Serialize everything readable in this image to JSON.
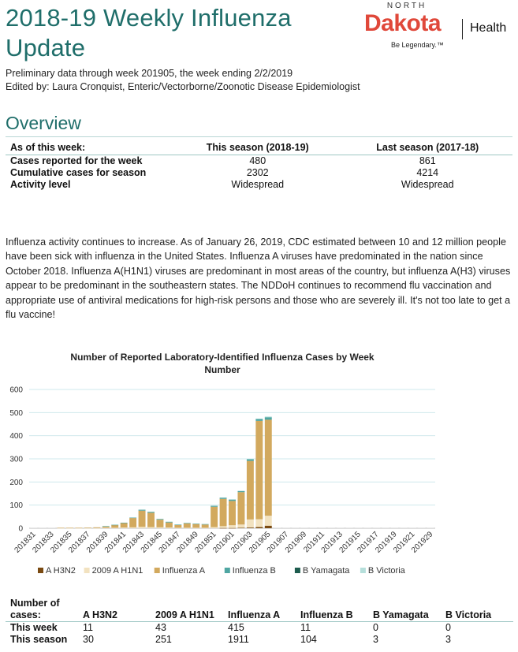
{
  "header": {
    "title": "2018-19 Weekly Influenza Update",
    "subtitle1": "Preliminary data through week 201905, the week ending 2/2/2019",
    "subtitle2": "Edited by: Laura Cronquist, Enteric/Vectorborne/Zoonotic Disease Epidemiologist"
  },
  "logo": {
    "north": "NORTH",
    "dakota": "Dakota",
    "health": "Health",
    "slogan": "Be Legendary.™"
  },
  "overview": {
    "heading": "Overview",
    "columns": [
      "As of this week:",
      "This season (2018-19)",
      "Last season (2017-18)"
    ],
    "rows": [
      {
        "label": "Cases reported for the week",
        "this": "480",
        "last": "861"
      },
      {
        "label": "Cumulative cases for season",
        "this": "2302",
        "last": "4214"
      },
      {
        "label": "Activity level",
        "this": "Widespread",
        "last": "Widespread"
      }
    ]
  },
  "paragraph": "Influenza activity continues to increase. As of January 26, 2019, CDC estimated between 10 and 12 million people have been sick with influenza in the United States. Influenza A viruses have predominated in the nation since October 2018. Influenza A(H1N1) viruses are predominant in most areas of the country, but influenza A(H3) viruses appear to be predominant in the southeastern states. The NDDoH continues to recommend flu vaccination and appropriate use of antiviral medications for high-risk persons and those who are severely ill. It's not too late to get a flu vaccine!",
  "chart_data": {
    "type": "bar",
    "stacked": true,
    "title": "Number of Reported Laboratory-Identified Influenza Cases by Week Number",
    "title_lines": [
      "Number of Reported Laboratory-Identified Influenza Cases by Week",
      "Number"
    ],
    "ylim": [
      0,
      600
    ],
    "yticks": [
      0,
      100,
      200,
      300,
      400,
      500,
      600
    ],
    "grid": true,
    "legend_position": "bottom",
    "categories": [
      "201831",
      "201832",
      "201833",
      "201834",
      "201835",
      "201836",
      "201837",
      "201838",
      "201839",
      "201840",
      "201841",
      "201842",
      "201843",
      "201844",
      "201845",
      "201846",
      "201847",
      "201848",
      "201849",
      "201850",
      "201851",
      "201852",
      "201901",
      "201902",
      "201903",
      "201904",
      "201905",
      "201906",
      "201907",
      "201908",
      "201909",
      "201910",
      "201911",
      "201912",
      "201913",
      "201914",
      "201915",
      "201916",
      "201917",
      "201918",
      "201919",
      "201920",
      "201921",
      "201922",
      "201929"
    ],
    "tick_labels": [
      "201831",
      "201833",
      "201835",
      "201837",
      "201839",
      "201841",
      "201843",
      "201845",
      "201847",
      "201849",
      "201851",
      "201901",
      "201903",
      "201905",
      "201907",
      "201909",
      "201911",
      "201913",
      "201915",
      "201917",
      "201919",
      "201921",
      "201929"
    ],
    "series": [
      {
        "name": "A H3N2",
        "color": "#7a4a12",
        "values": [
          0,
          0,
          0,
          0,
          0,
          0,
          0,
          0,
          0,
          0,
          0,
          0,
          0,
          0,
          0,
          0,
          0,
          0,
          0,
          0,
          0,
          1,
          1,
          2,
          3,
          5,
          11,
          0,
          0,
          0,
          0,
          0,
          0,
          0,
          0,
          0,
          0,
          0,
          0,
          0,
          0,
          0,
          0,
          0,
          0
        ]
      },
      {
        "name": "2009 A H1N1",
        "color": "#f2e2c0",
        "values": [
          0,
          0,
          0,
          1,
          1,
          1,
          1,
          1,
          2,
          2,
          3,
          4,
          6,
          5,
          4,
          3,
          2,
          2,
          2,
          2,
          5,
          8,
          12,
          14,
          35,
          34,
          43,
          0,
          0,
          0,
          0,
          0,
          0,
          0,
          0,
          0,
          0,
          0,
          0,
          0,
          0,
          0,
          0,
          0,
          0
        ]
      },
      {
        "name": "Influenza A",
        "color": "#d2a95e",
        "values": [
          0,
          0,
          0,
          1,
          1,
          1,
          2,
          3,
          6,
          12,
          20,
          40,
          70,
          62,
          33,
          22,
          12,
          19,
          16,
          14,
          88,
          118,
          105,
          140,
          253,
          425,
          415,
          0,
          0,
          0,
          0,
          0,
          0,
          0,
          0,
          0,
          0,
          0,
          0,
          0,
          0,
          0,
          0,
          0,
          0
        ]
      },
      {
        "name": "Influenza B",
        "color": "#4fa6a2",
        "values": [
          0,
          0,
          0,
          0,
          0,
          0,
          0,
          0,
          1,
          1,
          1,
          2,
          4,
          4,
          3,
          3,
          2,
          2,
          2,
          2,
          4,
          5,
          6,
          5,
          8,
          9,
          11,
          0,
          0,
          0,
          0,
          0,
          0,
          0,
          0,
          0,
          0,
          0,
          0,
          0,
          0,
          0,
          0,
          0,
          0
        ]
      },
      {
        "name": "B Yamagata",
        "color": "#1d5c4e",
        "values": [
          0,
          0,
          0,
          0,
          0,
          0,
          0,
          0,
          0,
          0,
          0,
          0,
          0,
          0,
          0,
          0,
          0,
          0,
          0,
          0,
          0,
          0,
          0,
          0,
          0,
          0,
          0,
          0,
          0,
          0,
          0,
          0,
          0,
          0,
          0,
          0,
          0,
          0,
          0,
          0,
          0,
          0,
          0,
          0,
          0
        ]
      },
      {
        "name": "B Victoria",
        "color": "#b6dfdb",
        "values": [
          0,
          0,
          0,
          0,
          0,
          0,
          0,
          0,
          0,
          0,
          0,
          0,
          0,
          0,
          0,
          0,
          0,
          0,
          0,
          0,
          0,
          0,
          0,
          0,
          1,
          1,
          3,
          0,
          0,
          0,
          0,
          0,
          0,
          0,
          0,
          0,
          0,
          0,
          0,
          0,
          0,
          0,
          0,
          0,
          0
        ]
      }
    ]
  },
  "cases_table": {
    "header_label": "Number of cases:",
    "columns": [
      "A H3N2",
      "2009 A H1N1",
      "Influenza A",
      "Influenza B",
      "B Yamagata",
      "B Victoria"
    ],
    "rows": [
      {
        "label": "This week",
        "values": [
          "11",
          "43",
          "415",
          "11",
          "0",
          "0"
        ]
      },
      {
        "label": "This season",
        "values": [
          "30",
          "251",
          "1911",
          "104",
          "3",
          "3"
        ]
      }
    ]
  }
}
